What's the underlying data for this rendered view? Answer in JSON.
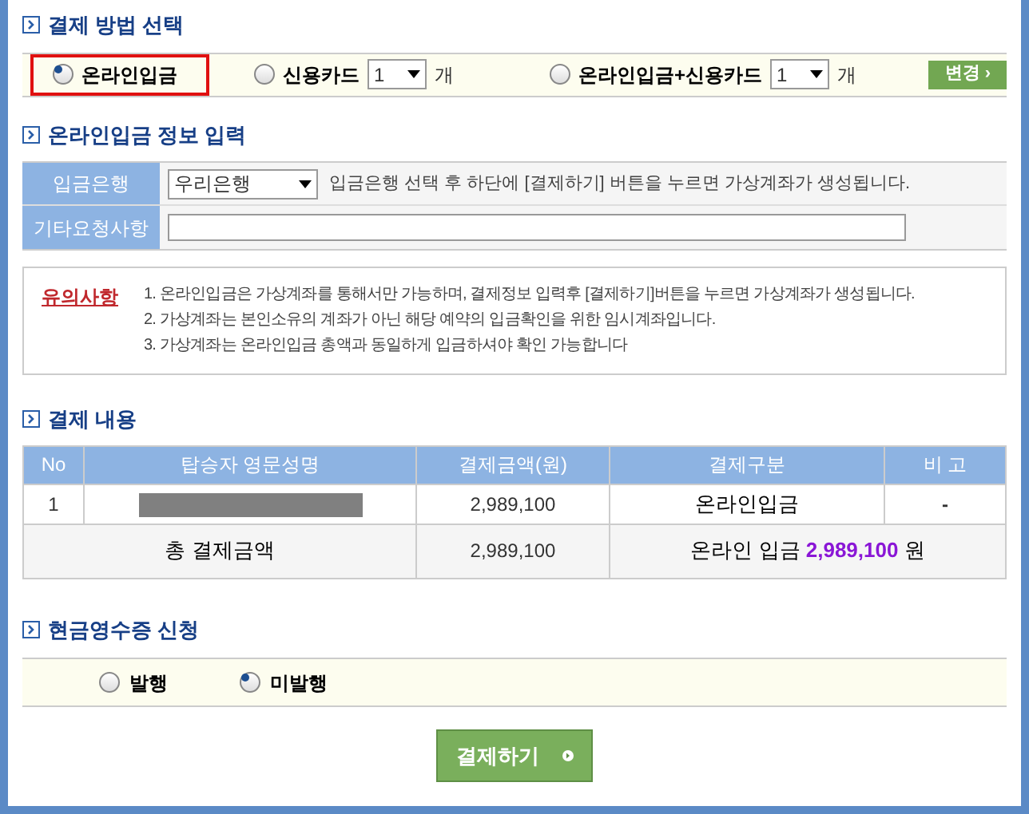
{
  "payment_method": {
    "title": "결제 방법 선택",
    "options": [
      {
        "label": "온라인입금",
        "selected": true
      },
      {
        "label": "신용카드",
        "selected": false,
        "quantity": "1",
        "unit": "개"
      },
      {
        "label": "온라인입금+신용카드",
        "selected": false,
        "quantity": "1",
        "unit": "개"
      }
    ],
    "change_button": "변경 ›"
  },
  "deposit_info": {
    "title": "온라인입금 정보 입력",
    "bank_label": "입금은행",
    "bank": "우리은행",
    "bank_hint": "입금은행 선택 후 하단에 [결제하기] 버튼을 누르면 가상계좌가 생성됩니다.",
    "request_label": "기타요청사항"
  },
  "notice": {
    "title": "유의사항",
    "lines": [
      "1. 온라인입금은 가상계좌를 통해서만 가능하며, 결제정보 입력후 [결제하기]버튼을 누르면 가상계좌가 생성됩니다.",
      "2. 가상계좌는 본인소유의 계좌가 아닌 해당 예약의 입금확인을 위한 임시계좌입니다.",
      "3. 가상계좌는 온라인입금 총액과 동일하게 입금하셔야 확인 가능합니다"
    ]
  },
  "payment_details": {
    "title": "결제 내용",
    "columns": [
      "No",
      "탑승자 영문성명",
      "결제금액(원)",
      "결제구분",
      "비 고"
    ],
    "rows": [
      {
        "no": "1",
        "name_redacted": true,
        "amount": "2,989,100",
        "type": "온라인입금",
        "note": "-"
      }
    ],
    "total": {
      "label": "총 결제금액",
      "amount": "2,989,100",
      "summary_prefix": "온라인 입금",
      "summary_amount": "2,989,100",
      "summary_unit": "원"
    }
  },
  "cash_receipt": {
    "title": "현금영수증 신청",
    "options": [
      {
        "label": "발행",
        "selected": false
      },
      {
        "label": "미발행",
        "selected": true
      }
    ]
  },
  "submit_button": "결제하기"
}
